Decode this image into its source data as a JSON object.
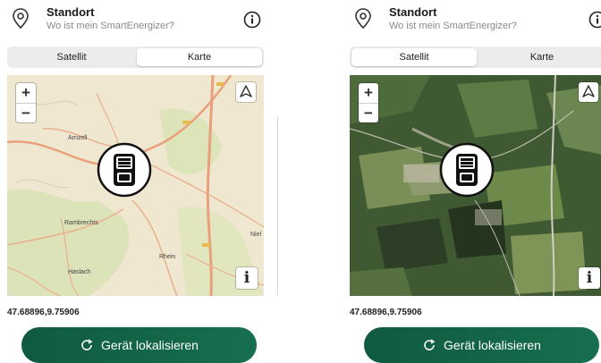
{
  "panels": [
    {
      "header": {
        "title": "Standort",
        "subtitle": "Wo ist mein SmartEnergizer?"
      },
      "segmented": {
        "options": [
          "Satellit",
          "Karte"
        ],
        "selected": "Karte"
      },
      "map": {
        "mode": "map",
        "labels": {
          "town1": "Arnzell",
          "town2": "Rambrechts",
          "town3": "Haslach",
          "town4": "Rhein",
          "town5": "Niel"
        }
      },
      "coordinates": "47.68896,9.75906",
      "locate_button": "Gerät lokalisieren"
    },
    {
      "header": {
        "title": "Standort",
        "subtitle": "Wo ist mein SmartEnergizer?"
      },
      "segmented": {
        "options": [
          "Satellit",
          "Karte"
        ],
        "selected": "Satellit"
      },
      "map": {
        "mode": "satellite"
      },
      "coordinates": "47.68896,9.75906",
      "locate_button": "Gerät lokalisieren"
    }
  ],
  "icons": [
    "location-pin-icon",
    "info-circle-icon",
    "zoom-in-icon",
    "zoom-out-icon",
    "compass-icon",
    "map-info-icon",
    "smart-energizer-device-icon",
    "refresh-icon"
  ],
  "colors": {
    "button_bg": "#136645",
    "map_bg": "#efe7cf",
    "forest": "#c9dca8",
    "road": "#e9a07a",
    "satellite_bg": "#3f5a32"
  }
}
